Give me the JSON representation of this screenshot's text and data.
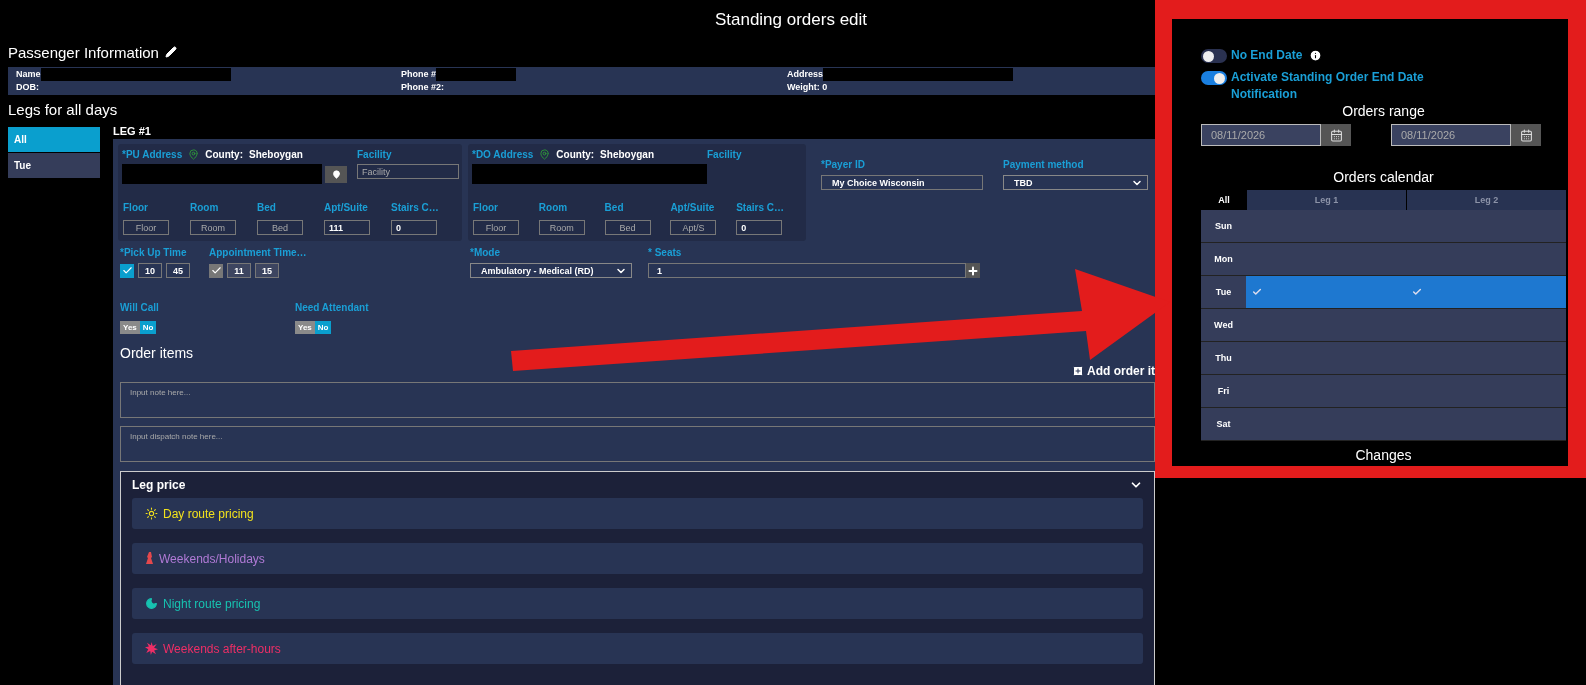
{
  "title": "Standing orders edit",
  "passenger": {
    "heading": "Passenger Information",
    "fields": [
      {
        "label": "Name",
        "redacted": true
      },
      {
        "label": "Phone #",
        "redacted": true
      },
      {
        "label": "Address",
        "redacted": true
      },
      {
        "label": "DOB:",
        "redacted": false
      },
      {
        "label": "Phone #2:",
        "redacted": false
      },
      {
        "label": "Weight: 0",
        "redacted": false
      }
    ]
  },
  "legs_heading": "Legs for all days",
  "day_tabs": [
    {
      "label": "All",
      "selected": true
    },
    {
      "label": "Tue",
      "selected": false
    }
  ],
  "leg": {
    "title": "LEG #1",
    "stops": [
      {
        "label": "*PU Address",
        "county_label": "County:",
        "county": "Sheboygan",
        "facility": {
          "label": "Facility",
          "placeholder": "Facility"
        },
        "details": [
          {
            "label": "Floor",
            "placeholder": "Floor"
          },
          {
            "label": "Room",
            "placeholder": "Room"
          },
          {
            "label": "Bed",
            "placeholder": "Bed"
          },
          {
            "label": "Apt/Suite",
            "value": "111"
          },
          {
            "label": "Stairs C…",
            "value": "0"
          }
        ]
      },
      {
        "label": "*DO Address",
        "county_label": "County:",
        "county": "Sheboygan",
        "facility": {
          "label": "Facility"
        },
        "details": [
          {
            "label": "Floor",
            "placeholder": "Floor"
          },
          {
            "label": "Room",
            "placeholder": "Room"
          },
          {
            "label": "Bed",
            "placeholder": "Bed"
          },
          {
            "label": "Apt/Suite",
            "placeholder": "Apt/S"
          },
          {
            "label": "Stairs C…",
            "value": "0"
          }
        ]
      }
    ],
    "payer": {
      "label": "*Payer ID",
      "value": "My Choice Wisconsin"
    },
    "payment": {
      "label": "Payment method",
      "value": "TBD"
    },
    "times": [
      {
        "label": "*Pick Up Time",
        "checked": true,
        "disabled": false,
        "hour": "10",
        "minute": "45"
      },
      {
        "label": "Appointment Time…",
        "checked": true,
        "disabled": true,
        "hour": "11",
        "minute": "15"
      }
    ],
    "mode": {
      "label": "*Mode",
      "value": "Ambulatory - Medical (RD)"
    },
    "seats": {
      "label": "* Seats",
      "value": "1"
    },
    "switches": [
      {
        "label": "Will Call",
        "options": [
          {
            "label": "Yes",
            "selected": false
          },
          {
            "label": "No",
            "selected": true
          }
        ]
      },
      {
        "label": "Need Attendant",
        "options": [
          {
            "label": "Yes",
            "selected": false
          },
          {
            "label": "No",
            "selected": true
          }
        ]
      }
    ],
    "order_items": {
      "heading": "Order items",
      "add": "Add order it",
      "notes": [
        {
          "placeholder": "Input note here..."
        },
        {
          "placeholder": "Input dispatch note here..."
        }
      ]
    },
    "leg_price": {
      "title": "Leg price",
      "expanded": true,
      "items": [
        {
          "kind": "day",
          "label": "Day route pricing",
          "color": "#f2e21c"
        },
        {
          "kind": "weekend",
          "label": "Weekends/Holidays",
          "color": "#b07ad6"
        },
        {
          "kind": "night",
          "label": "Night route pricing",
          "color": "#17c2b0"
        },
        {
          "kind": "afterhours",
          "label": "Weekends after-hours",
          "color": "#ee2e66"
        }
      ]
    }
  },
  "side": {
    "toggles": [
      {
        "label": "No End Date",
        "on": false,
        "info": true
      },
      {
        "label": "Activate Standing Order End Date Notification",
        "on": true,
        "info": false
      }
    ],
    "range": {
      "title": "Orders range",
      "start": "08/11/2026",
      "end": "08/11/2026"
    },
    "calendar": {
      "title": "Orders calendar",
      "tabs": [
        {
          "label": "All",
          "selected": true
        },
        {
          "label": "Leg 1",
          "selected": false
        },
        {
          "label": "Leg 2",
          "selected": false
        }
      ],
      "days": [
        {
          "day": "Sun",
          "legs": [
            {
              "checked": false
            },
            {
              "checked": false
            }
          ]
        },
        {
          "day": "Mon",
          "legs": [
            {
              "checked": false
            },
            {
              "checked": false
            }
          ]
        },
        {
          "day": "Tue",
          "legs": [
            {
              "checked": true
            },
            {
              "checked": true
            }
          ]
        },
        {
          "day": "Wed",
          "legs": [
            {
              "checked": false
            },
            {
              "checked": false
            }
          ]
        },
        {
          "day": "Thu",
          "legs": [
            {
              "checked": false
            },
            {
              "checked": false
            }
          ]
        },
        {
          "day": "Fri",
          "legs": [
            {
              "checked": false
            },
            {
              "checked": false
            }
          ]
        },
        {
          "day": "Sat",
          "legs": [
            {
              "checked": false
            },
            {
              "checked": false
            }
          ]
        }
      ]
    },
    "changes_title": "Changes"
  }
}
